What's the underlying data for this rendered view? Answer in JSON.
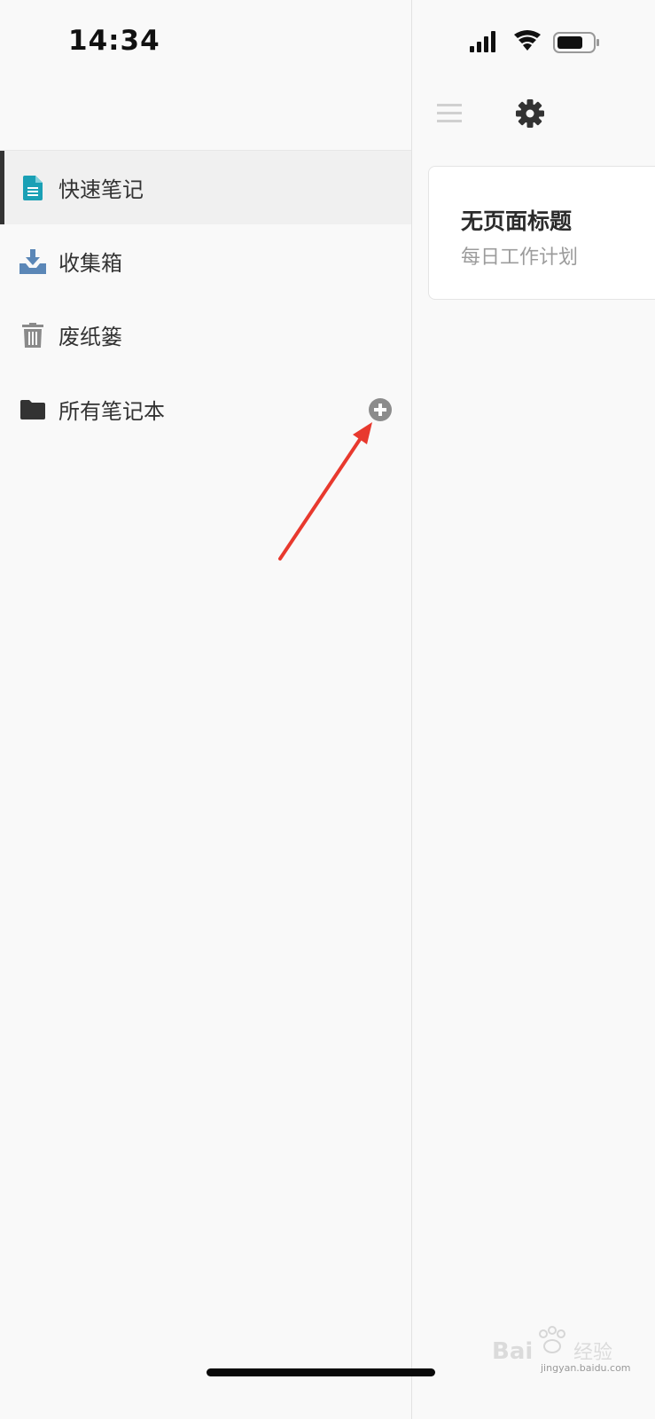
{
  "status_bar": {
    "time": "14:34"
  },
  "sidebar": {
    "items": [
      {
        "label": "快速笔记",
        "icon": "document-icon",
        "active": true,
        "icon_color": "#1aa0b5"
      },
      {
        "label": "收集箱",
        "icon": "inbox-download-icon",
        "active": false,
        "icon_color": "#5b87b7"
      },
      {
        "label": "废纸篓",
        "icon": "trash-icon",
        "active": false,
        "icon_color": "#8a8a8a"
      },
      {
        "label": "所有笔记本",
        "icon": "folder-icon",
        "active": false,
        "icon_color": "#333333"
      }
    ],
    "add_icon": "plus-circle-icon"
  },
  "toolbar": {
    "menu_icon": "hamburger-menu-icon",
    "settings_icon": "gear-icon"
  },
  "note_list": [
    {
      "title": "无页面标题",
      "subtitle": "每日工作计划"
    }
  ],
  "watermark": {
    "text": "jingyan.baidu.com"
  },
  "colors": {
    "accent_bar": "#333333",
    "annotation_arrow": "#e8392e"
  }
}
